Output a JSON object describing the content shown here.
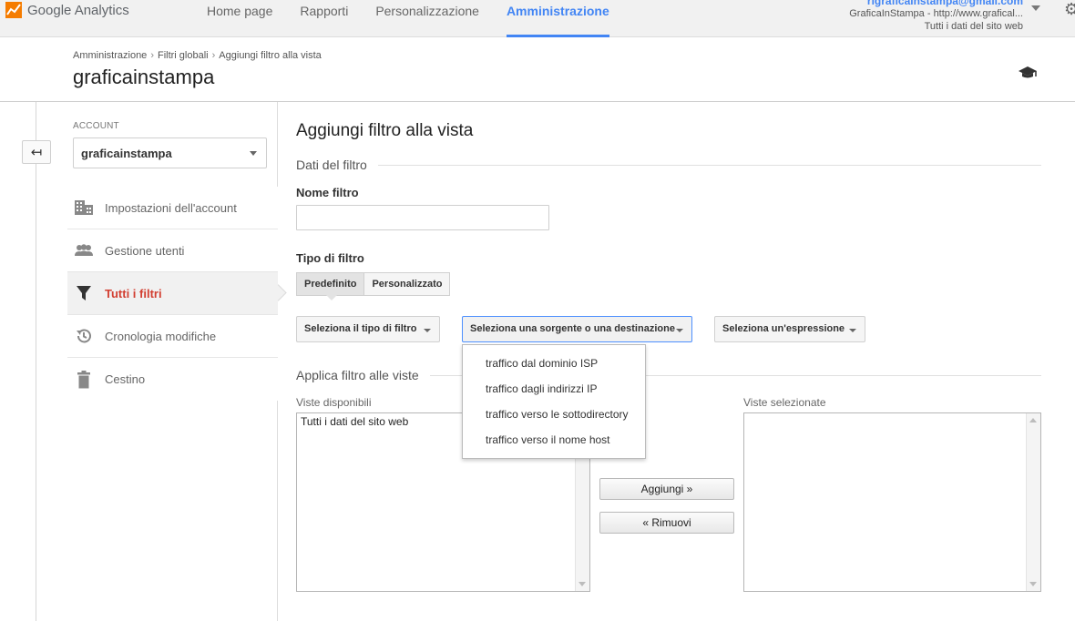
{
  "app": {
    "name": "Google Analytics",
    "logo_icon": "analytics-logo-icon"
  },
  "nav": {
    "items": [
      {
        "label": "Home page",
        "active": false
      },
      {
        "label": "Rapporti",
        "active": false
      },
      {
        "label": "Personalizzazione",
        "active": false
      },
      {
        "label": "Amministrazione",
        "active": true
      }
    ]
  },
  "account_picker": {
    "email": "rigraficainstampa@gmail.com",
    "property": "GraficaInStampa - http://www.grafical...",
    "view": "Tutti i dati del sito web"
  },
  "header": {
    "breadcrumb": [
      "Amministrazione",
      "Filtri globali",
      "Aggiungi filtro alla vista"
    ],
    "title": "graficainstampa"
  },
  "sidebar": {
    "account_label": "ACCOUNT",
    "account_value": "graficainstampa",
    "items": [
      {
        "label": "Impostazioni dell'account",
        "icon": "building-icon",
        "active": false
      },
      {
        "label": "Gestione utenti",
        "icon": "users-icon",
        "active": false
      },
      {
        "label": "Tutti i filtri",
        "icon": "filter-icon",
        "active": true
      },
      {
        "label": "Cronologia modifiche",
        "icon": "history-icon",
        "active": false
      },
      {
        "label": "Cestino",
        "icon": "trash-icon",
        "active": false
      }
    ]
  },
  "main": {
    "title": "Aggiungi filtro alla vista",
    "section_data": "Dati del filtro",
    "name_label": "Nome filtro",
    "name_value": "",
    "type_label": "Tipo di filtro",
    "type_options": [
      "Predefinito",
      "Personalizzato"
    ],
    "type_selected": "Predefinito",
    "dropdowns": {
      "filter_type": "Seleziona il tipo di filtro",
      "source_dest": "Seleziona una sorgente o una destinazione",
      "expression": "Seleziona un'espressione"
    },
    "source_dest_options": [
      "traffico dal dominio ISP",
      "traffico dagli indirizzi IP",
      "traffico verso le sottodirectory",
      "traffico verso il nome host"
    ],
    "section_apply": "Applica filtro alle viste",
    "available_label": "Viste disponibili",
    "available_views": [
      "Tutti i dati del sito web"
    ],
    "selected_label": "Viste selezionate",
    "selected_views": [],
    "add_button": "Aggiungi »",
    "remove_button": "« Rimuovi"
  }
}
